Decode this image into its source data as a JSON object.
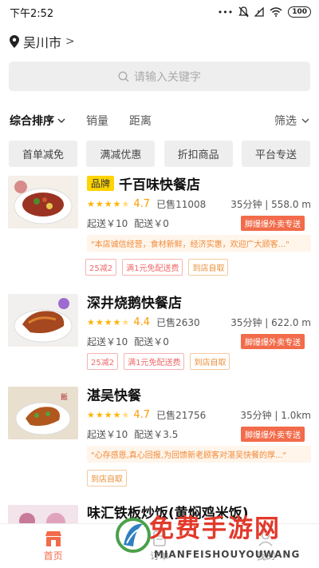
{
  "status_bar": {
    "time": "下午2:52",
    "battery": "100"
  },
  "location": {
    "city": "吴川市",
    "chevron": ">"
  },
  "search": {
    "placeholder": "请输入关键字"
  },
  "sort_bar": {
    "items": [
      "综合排序",
      "销量",
      "距离"
    ],
    "filter": "筛选"
  },
  "quick_tags": [
    "首单减免",
    "满减优惠",
    "折扣商品",
    "平台专送"
  ],
  "stores": [
    {
      "brand": "品牌",
      "name": "千百味快餐店",
      "stars": 4.5,
      "rating": "4.7",
      "sold": "已售11008",
      "distance": "35分钟 | 558.0 m",
      "min_order": "起送￥10",
      "delivery_fee": "配送￥0",
      "delivery_badge": "脚爆爆外卖专送",
      "quote": "\"本店诚信经营，食材新鲜，经济实惠，欢迎广大顾客...\"",
      "tags": [
        {
          "text": "25减2",
          "style": "red"
        },
        {
          "text": "满1元免配送费",
          "style": "red"
        },
        {
          "text": "到店自取",
          "style": "orange"
        }
      ]
    },
    {
      "brand": "",
      "name": "深井烧鹅快餐店",
      "stars": 4.5,
      "rating": "4.4",
      "sold": "已售2630",
      "distance": "35分钟 | 622.0 m",
      "min_order": "起送￥10",
      "delivery_fee": "配送￥0",
      "delivery_badge": "脚爆爆外卖专送",
      "quote": "",
      "tags": [
        {
          "text": "25减2",
          "style": "red"
        },
        {
          "text": "满1元免配送费",
          "style": "red"
        },
        {
          "text": "到店自取",
          "style": "orange"
        }
      ]
    },
    {
      "brand": "",
      "name": "湛吴快餐",
      "stars": 4.5,
      "rating": "4.7",
      "sold": "已售21756",
      "distance": "35分钟 | 1.0km",
      "min_order": "起送￥10",
      "delivery_fee": "配送￥3.5",
      "delivery_badge": "脚爆爆外卖专送",
      "quote": "\"心存感恩,真心回报,为回馈新老顾客对湛吴快餐的厚...\"",
      "tags": [
        {
          "text": "到店自取",
          "style": "orange"
        }
      ]
    },
    {
      "brand": "",
      "name": "味汇铁板炒饭(黄焖鸡米饭)",
      "stars": 0,
      "rating": "",
      "sold": "",
      "distance": "",
      "min_order": "",
      "delivery_fee": "",
      "delivery_badge": "",
      "quote": "",
      "tags": []
    }
  ],
  "bottom_nav": {
    "items": [
      "首页",
      "订单",
      "我的"
    ]
  },
  "watermark": {
    "title": "免费手游网",
    "subtitle": "MIANFEISHOUYOUWANG"
  },
  "colors": {
    "accent": "#f26b4a",
    "brand_badge": "#ffd400",
    "rating": "#ff9a00",
    "watermark": "#e2392b"
  }
}
